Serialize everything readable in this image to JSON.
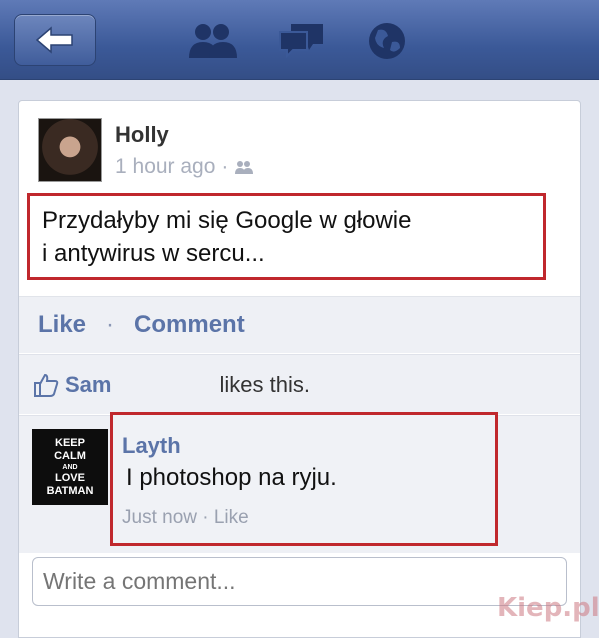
{
  "topbar": {
    "back_icon": "back-arrow-icon",
    "friend_requests_icon": "friends-icon",
    "messages_icon": "messages-icon",
    "notifications_icon": "globe-icon"
  },
  "post": {
    "author": "Holly",
    "time": "1 hour ago",
    "separator": "·",
    "privacy_icon": "friends-icon",
    "text_line1": "Przydałyby mi się Google w głowie",
    "text_line2": "i antywirus w sercu..."
  },
  "actions": {
    "like": "Like",
    "separator": "·",
    "comment": "Comment"
  },
  "likes": {
    "icon": "thumbs-up-icon",
    "liker": "Sam",
    "text": "likes this."
  },
  "comment": {
    "author": "Layth",
    "text": "I photoshop na ryju.",
    "meta": "Just now · Like",
    "avatar_lines": [
      "KEEP",
      "CALM",
      "AND",
      "LOVE",
      "BATMAN"
    ]
  },
  "composer": {
    "placeholder": "Write a comment..."
  },
  "watermark": "Kiep.pl",
  "colors": {
    "brand": "#3b5998",
    "link": "#5b74a8",
    "highlight": "#c0282d"
  }
}
